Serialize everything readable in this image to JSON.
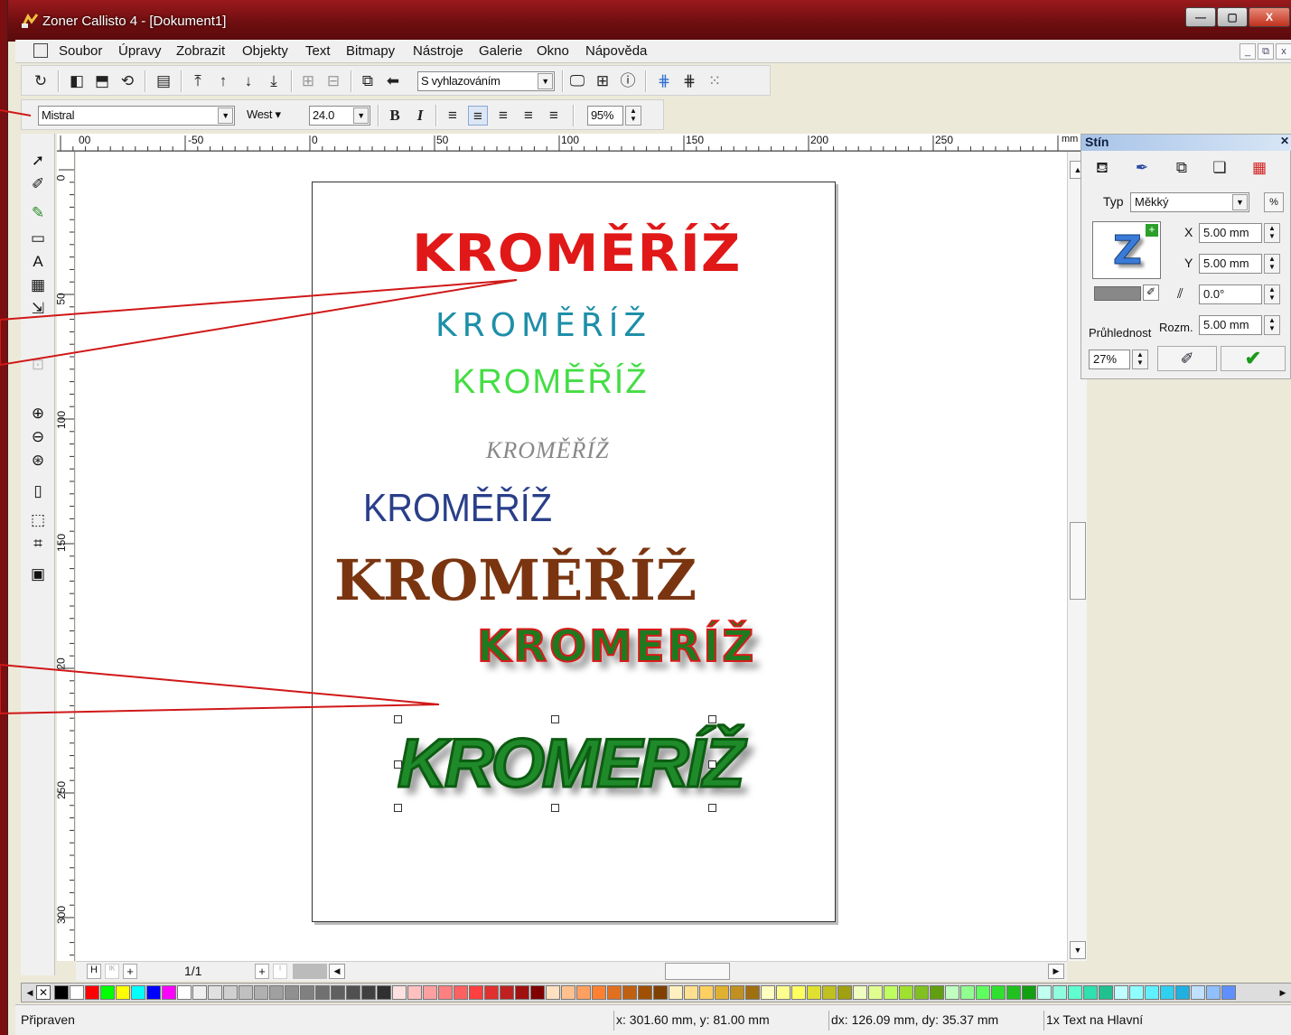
{
  "window": {
    "title": "Zoner Callisto 4 - [Dokument1]",
    "buttons": [
      "—",
      "▢",
      "X"
    ]
  },
  "menu": [
    "Soubor",
    "Úpravy",
    "Zobrazit",
    "Objekty",
    "Text",
    "Bitmapy",
    "Nástroje",
    "Galerie",
    "Okno",
    "Nápověda"
  ],
  "mdi_buttons": [
    "_",
    "⧉",
    "x"
  ],
  "toolbar": {
    "antialias_mode": "S vyhlazováním",
    "font_name": "Mistral",
    "font_style": "West",
    "font_size": "24.0",
    "bold": "B",
    "italic": "I",
    "zoom": "95%"
  },
  "rulers": {
    "horizontal": [
      "00",
      "-50",
      "0",
      "50",
      "100",
      "150",
      "200",
      "250"
    ],
    "unit": "mm",
    "vertical": [
      "0",
      "50",
      "100",
      "150",
      "20",
      "250",
      "300"
    ]
  },
  "document": {
    "texts": [
      {
        "text": "KROMĚŘÍŽ",
        "color": "#e11818"
      },
      {
        "text": "KROMĚŘÍŽ",
        "color": "#1e8fa8"
      },
      {
        "text": "KROMĚŘÍŽ",
        "color": "#44dd44"
      },
      {
        "text": "KROMĚŘÍŽ",
        "color": "#888888"
      },
      {
        "text": "KROMĚŘÍŽ",
        "color": "#2a3f8a"
      },
      {
        "text": "KROMĚŘÍŽ",
        "color": "#7a3510"
      },
      {
        "text": "KROMERÍŽ",
        "color": "#1f7a1f",
        "outline": "#d81b1b"
      },
      {
        "text": "KROMERÍŽ",
        "color": "#1f8a2a",
        "outline": "#0d5c12"
      }
    ]
  },
  "page_nav": {
    "first": "H",
    "prev": "ᴵᴷ",
    "add": "+",
    "counter": "1/1",
    "add_after": "+",
    "next": "ᴵ"
  },
  "shadow_panel": {
    "title": "Stín",
    "type_label": "Typ",
    "type_value": "Měkký",
    "percent_button": "%",
    "x_label": "X",
    "x_value": "5.00 mm",
    "y_label": "Y",
    "y_value": "5.00 mm",
    "angle_value": "0.0°",
    "opacity_label": "Průhlednost",
    "size_label": "Rozm.",
    "size_value": "5.00 mm",
    "opacity_value": "27%",
    "preview_letter": "Z"
  },
  "palette_colors": [
    "#000000",
    "#ffffff",
    "#ff0000",
    "#00ff00",
    "#ffff00",
    "#00ffff",
    "#0000ff",
    "#ff00ff",
    "#ffffff",
    "#f0f0f0",
    "#e0e0e0",
    "#d0d0d0",
    "#c0c0c0",
    "#b0b0b0",
    "#a0a0a0",
    "#909090",
    "#808080",
    "#707070",
    "#606060",
    "#505050",
    "#404040",
    "#303030",
    "#ffe0e0",
    "#ffc0c0",
    "#ffa0a0",
    "#ff8080",
    "#ff6060",
    "#ff4040",
    "#e03030",
    "#c02020",
    "#a01010",
    "#800000",
    "#ffe0c0",
    "#ffc090",
    "#ffa060",
    "#ff8030",
    "#e07020",
    "#c06010",
    "#a05000",
    "#804000",
    "#fff0c0",
    "#ffe090",
    "#ffd060",
    "#e0b030",
    "#c09020",
    "#a07010",
    "#ffffc0",
    "#ffff90",
    "#ffff60",
    "#e0e030",
    "#c0c020",
    "#a0a010",
    "#f0ffc0",
    "#e0ff90",
    "#c0ff60",
    "#a0e030",
    "#80c020",
    "#60a010",
    "#c0ffc0",
    "#90ff90",
    "#60ff60",
    "#30e030",
    "#20c020",
    "#10a010",
    "#c0fff0",
    "#90ffe0",
    "#60ffd0",
    "#30e0b0",
    "#20c090",
    "#c0ffff",
    "#90ffff",
    "#60f0ff",
    "#30d0f0",
    "#20b0e0",
    "#c0e0ff",
    "#90c0ff",
    "#6090ff"
  ],
  "status": {
    "ready": "Připraven",
    "cursor": "x: 301.60 mm, y: 81.00 mm",
    "delta": "dx: 126.09 mm, dy: 35.37 mm",
    "selection": "1x Text na Hlavní"
  }
}
